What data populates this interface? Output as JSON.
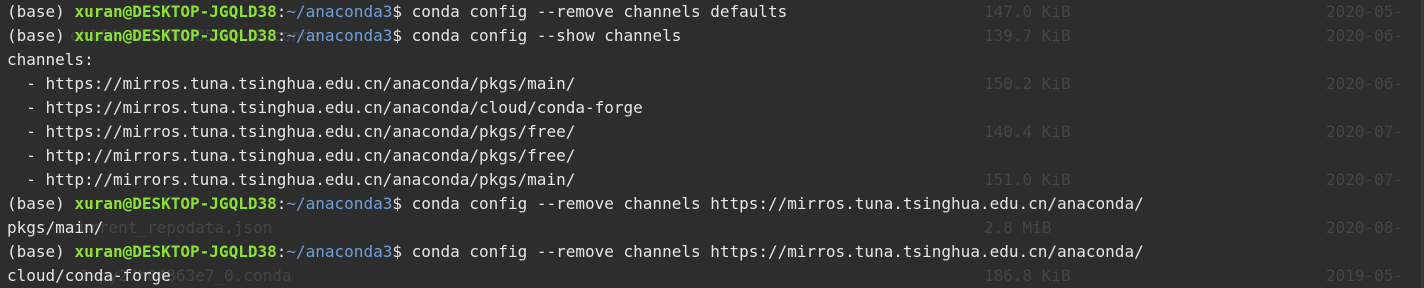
{
  "window": {
    "background": "#2d2d2d",
    "colors": {
      "text": "#e6e6e6",
      "user_host": "#8ae234",
      "path": "#6f9fd8",
      "ghost": "#444444"
    }
  },
  "prompt": {
    "env": "(base) ",
    "user_host": "xuran@DESKTOP-JGQLD38",
    "sep": ":",
    "cwd": "~/anaconda3",
    "symbol": "$ "
  },
  "lines": [
    {
      "type": "prompt",
      "command": "conda config --remove channels defaults"
    },
    {
      "type": "prompt",
      "command": "conda config --show channels"
    },
    {
      "type": "output",
      "text": "channels:"
    },
    {
      "type": "output",
      "text": "  - https://mirros.tuna.tsinghua.edu.cn/anaconda/pkgs/main/"
    },
    {
      "type": "output",
      "text": "  - https://mirros.tuna.tsinghua.edu.cn/anaconda/cloud/conda-forge"
    },
    {
      "type": "output",
      "text": "  - https://mirros.tuna.tsinghua.edu.cn/anaconda/pkgs/free/"
    },
    {
      "type": "output",
      "text": "  - http://mirrors.tuna.tsinghua.edu.cn/anaconda/pkgs/free/"
    },
    {
      "type": "output",
      "text": "  - http://mirrors.tuna.tsinghua.edu.cn/anaconda/pkgs/main/"
    },
    {
      "type": "prompt",
      "command": "conda config --remove channels https://mirros.tuna.tsinghua.edu.cn/anaconda/"
    },
    {
      "type": "output",
      "text": "pkgs/main/"
    },
    {
      "type": "prompt",
      "command": "conda config --remove channels https://mirros.tuna.tsinghua.edu.cn/anaconda/"
    },
    {
      "type": "output",
      "text": "cloud/conda-forge"
    }
  ],
  "ghost_text": {
    "files": [
      "",
      "eh164/210-h0c8564/_0.conda",
      "",
      "",
      "",
      "",
      "",
      "",
      "",
      "current_repodata.json",
      "",
      "-1-py27h04863e7_0.conda"
    ],
    "sizes": [
      "147.0 KiB",
      "139.7 KiB",
      "",
      "150.2 KiB",
      "",
      "140.4 KiB",
      "",
      "151.0 KiB",
      "",
      "2.8 MiB",
      "",
      "186.8 KiB"
    ],
    "dates": [
      "2020-05-",
      "2020-06-",
      "",
      "2020-06-",
      "",
      "2020-07-",
      "",
      "2020-07-",
      "",
      "2020-08-",
      "",
      "2019-05-"
    ]
  }
}
